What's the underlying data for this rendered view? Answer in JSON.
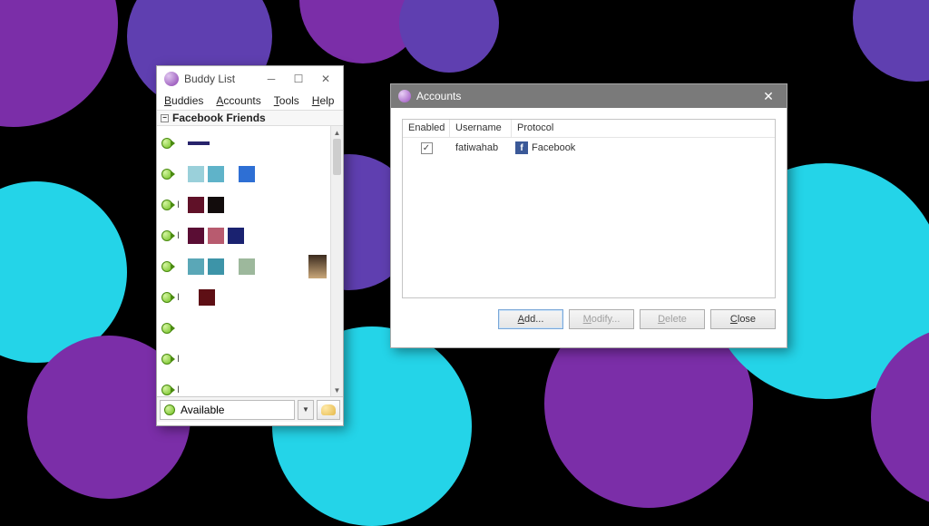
{
  "buddy_list": {
    "title": "Buddy List",
    "menu": {
      "buddies": "Buddies",
      "accounts": "Accounts",
      "tools": "Tools",
      "help": "Help"
    },
    "group_header": "Facebook Friends",
    "status": {
      "label": "Available"
    }
  },
  "accounts": {
    "title": "Accounts",
    "headers": {
      "enabled": "Enabled",
      "username": "Username",
      "protocol": "Protocol"
    },
    "rows": [
      {
        "enabled": true,
        "username": "fatiwahab",
        "protocol": "Facebook"
      }
    ],
    "buttons": {
      "add": "Add...",
      "modify": "Modify...",
      "delete": "Delete",
      "close": "Close"
    }
  }
}
